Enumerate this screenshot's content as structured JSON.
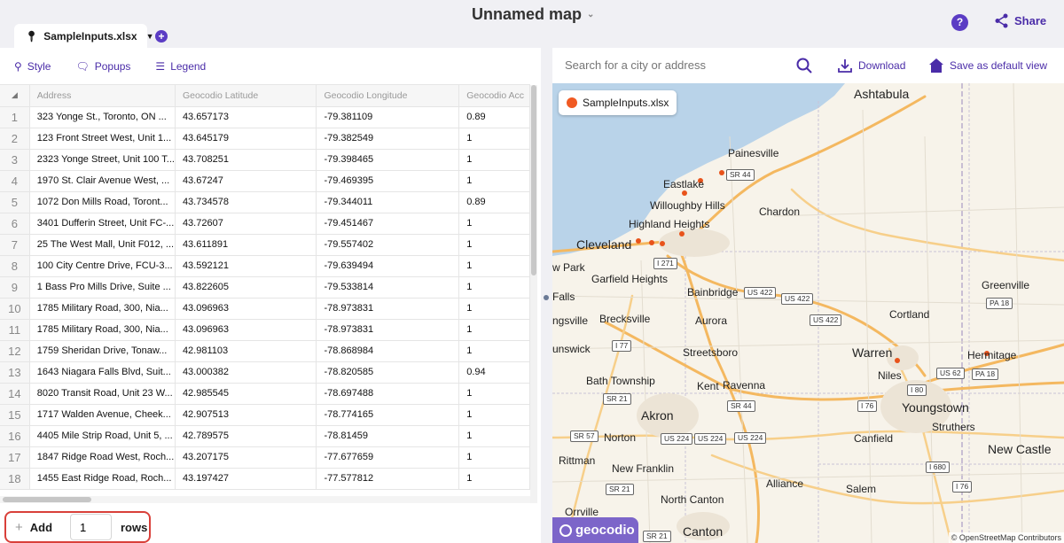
{
  "header": {
    "title": "Unnamed map",
    "share_label": "Share",
    "help_label": "?"
  },
  "file_tab": {
    "label": "SampleInputs.xlsx"
  },
  "toolbar": {
    "style_label": "Style",
    "popups_label": "Popups",
    "legend_label": "Legend"
  },
  "table": {
    "columns": [
      "Address",
      "Geocodio Latitude",
      "Geocodio Longitude",
      "Geocodio Acc"
    ],
    "rows": [
      {
        "n": "1",
        "address": "323 Yonge St., Toronto, ON ...",
        "lat": "43.657173",
        "lng": "-79.381109",
        "acc": "0.89"
      },
      {
        "n": "2",
        "address": "123 Front Street West, Unit 1...",
        "lat": "43.645179",
        "lng": "-79.382549",
        "acc": "1"
      },
      {
        "n": "3",
        "address": "2323 Yonge Street, Unit 100 T...",
        "lat": "43.708251",
        "lng": "-79.398465",
        "acc": "1"
      },
      {
        "n": "4",
        "address": "1970 St. Clair Avenue West, ...",
        "lat": "43.67247",
        "lng": "-79.469395",
        "acc": "1"
      },
      {
        "n": "5",
        "address": "1072 Don Mills Road, Toront...",
        "lat": "43.734578",
        "lng": "-79.344011",
        "acc": "0.89"
      },
      {
        "n": "6",
        "address": "3401 Dufferin Street, Unit FC-...",
        "lat": "43.72607",
        "lng": "-79.451467",
        "acc": "1"
      },
      {
        "n": "7",
        "address": "25 The West Mall, Unit F012, ...",
        "lat": "43.611891",
        "lng": "-79.557402",
        "acc": "1"
      },
      {
        "n": "8",
        "address": "100 City Centre Drive, FCU-3...",
        "lat": "43.592121",
        "lng": "-79.639494",
        "acc": "1"
      },
      {
        "n": "9",
        "address": "1 Bass Pro Mills Drive, Suite ...",
        "lat": "43.822605",
        "lng": "-79.533814",
        "acc": "1"
      },
      {
        "n": "10",
        "address": "1785 Military Road, 300, Nia...",
        "lat": "43.096963",
        "lng": "-78.973831",
        "acc": "1"
      },
      {
        "n": "11",
        "address": "1785 Military Road, 300, Nia...",
        "lat": "43.096963",
        "lng": "-78.973831",
        "acc": "1"
      },
      {
        "n": "12",
        "address": "1759 Sheridan Drive, Tonaw...",
        "lat": "42.981103",
        "lng": "-78.868984",
        "acc": "1"
      },
      {
        "n": "13",
        "address": "1643 Niagara Falls Blvd, Suit...",
        "lat": "43.000382",
        "lng": "-78.820585",
        "acc": "0.94"
      },
      {
        "n": "14",
        "address": "8020 Transit Road, Unit 23 W...",
        "lat": "42.985545",
        "lng": "-78.697488",
        "acc": "1"
      },
      {
        "n": "15",
        "address": "1717 Walden Avenue, Cheek...",
        "lat": "42.907513",
        "lng": "-78.774165",
        "acc": "1"
      },
      {
        "n": "16",
        "address": "4405 Mile Strip Road, Unit 5, ...",
        "lat": "42.789575",
        "lng": "-78.81459",
        "acc": "1"
      },
      {
        "n": "17",
        "address": "1847 Ridge Road West, Roch...",
        "lat": "43.207175",
        "lng": "-77.677659",
        "acc": "1"
      },
      {
        "n": "18",
        "address": "1455 East Ridge Road, Roch...",
        "lat": "43.197427",
        "lng": "-77.577812",
        "acc": "1"
      }
    ]
  },
  "add_rows": {
    "add_label": "Add",
    "count_value": "1",
    "rows_label": "rows"
  },
  "map_toolbar": {
    "search_placeholder": "Search for a city or address",
    "download_label": "Download",
    "save_default_label": "Save as default view"
  },
  "map": {
    "legend_label": "SampleInputs.xlsx",
    "legend_color": "#f05a23",
    "brand": "geocodio",
    "attribution": "© OpenStreetMap Contributors",
    "places": [
      "Ashtabula",
      "Painesville",
      "Eastlake",
      "Willoughby Hills",
      "Chardon",
      "Highland Heights",
      "Cleveland",
      "w Park",
      "Garfield Heights",
      "Bainbridge",
      "Greenville",
      "Falls",
      "ngsville",
      "Brecksville",
      "Aurora",
      "Cortland",
      "unswick",
      "Streetsboro",
      "Warren",
      "Hermitage",
      "Niles",
      "Bath Township",
      "Kent",
      "Ravenna",
      "Youngstown",
      "Akron",
      "Struthers",
      "Norton",
      "Canfield",
      "New Castle",
      "Rittman",
      "New Franklin",
      "Alliance",
      "Salem",
      "North Canton",
      "Orrville",
      "Canton"
    ],
    "shields": [
      "SR 44",
      "I 271",
      "US 422",
      "US 422",
      "US 422",
      "PA 18",
      "I 77",
      "US 62",
      "PA 18",
      "I 80",
      "SR 21",
      "SR 44",
      "I 76",
      "SR 57",
      "US 224",
      "US 224",
      "US 224",
      "I 680",
      "SR 21",
      "I 76",
      "SR 21"
    ],
    "point_color": "#e8531b"
  }
}
